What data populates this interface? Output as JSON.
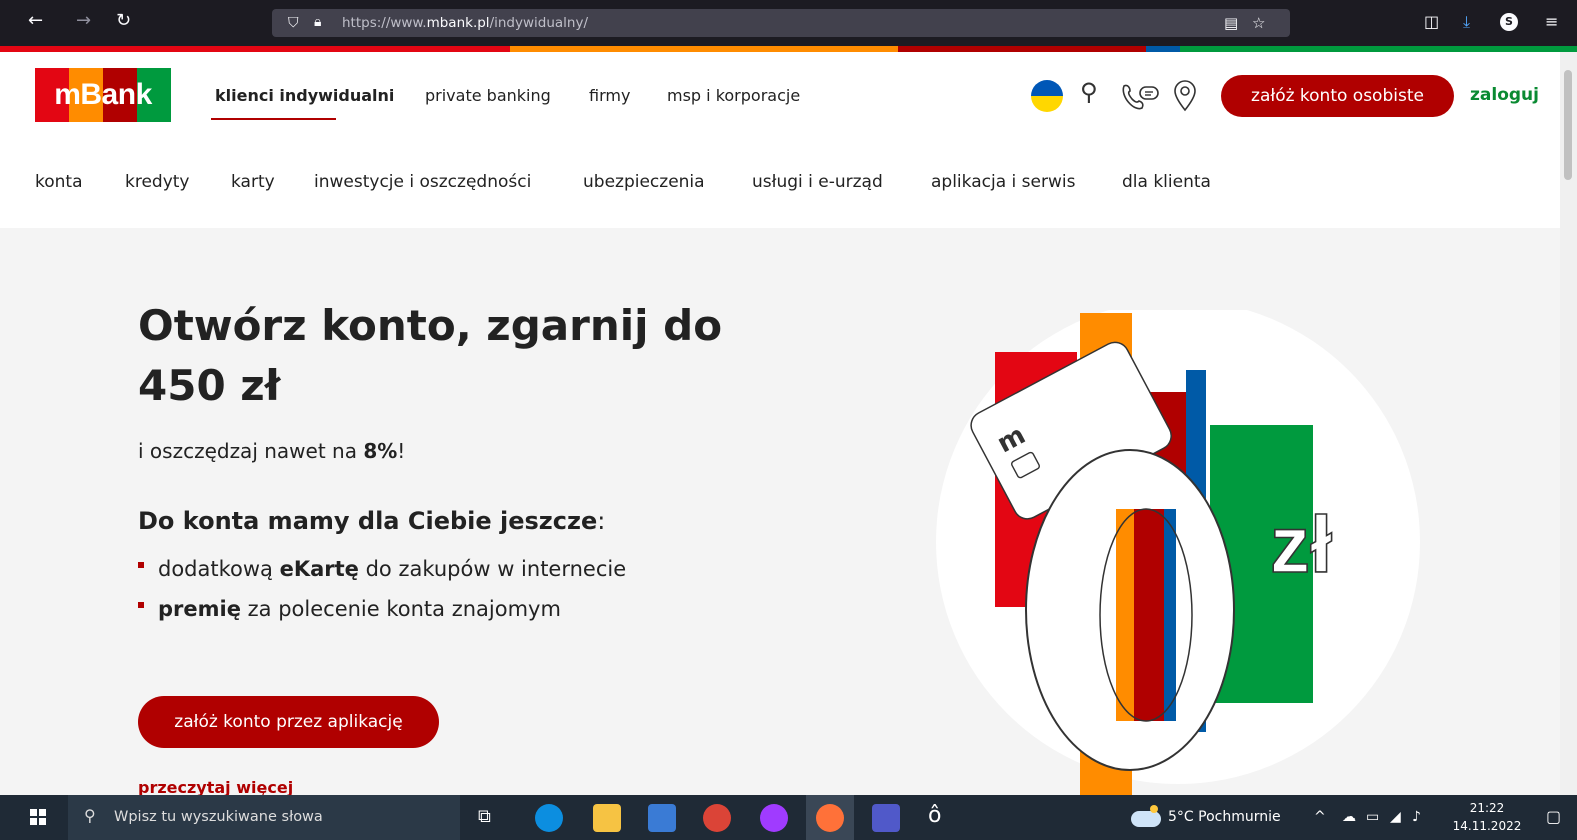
{
  "browser": {
    "url_prefix": "https://www.",
    "url_domain": "mbank.pl",
    "url_path": "/indywidualny/"
  },
  "header": {
    "logo_text": "mBank",
    "top_nav": [
      "klienci indywidualni",
      "private banking",
      "firmy",
      "msp i korporacje"
    ],
    "cta_label": "załóż konto osobiste",
    "login_label": "zaloguj",
    "sub_nav": [
      "konta",
      "kredyty",
      "karty",
      "inwestycje i oszczędności",
      "ubezpieczenia",
      "usługi i e-urząd",
      "aplikacja i serwis",
      "dla klienta"
    ]
  },
  "hero": {
    "title": "Otwórz konto, zgarnij do 450 zł",
    "subtitle_prefix": "i oszczędzaj nawet na ",
    "subtitle_bold": "8%",
    "subtitle_suffix": "!",
    "extras_title_bold": "Do konta mamy dla Ciebie jeszcze",
    "extras_title_suffix": ":",
    "bullets": [
      {
        "prefix": "dodatkową ",
        "bold": "eKartę",
        "suffix": " do zakupów w internecie"
      },
      {
        "prefix": "",
        "bold": "premię",
        "suffix": " za polecenie konta znajomym"
      }
    ],
    "cta_label": "załóż konto przez aplikację",
    "read_more": "przeczytaj więcej",
    "illustration_text": "0",
    "illustration_unit": "zł",
    "card_logo": "m"
  },
  "taskbar": {
    "search_placeholder": "Wpisz tu wyszukiwane słowa",
    "weather": "5°C  Pochmurnie",
    "time": "21:22",
    "date": "14.11.2022"
  },
  "colors": {
    "brand_red": "#b00000",
    "brand_green": "#0a8a32",
    "logo_blocks": [
      "#e30613",
      "#ff8c00",
      "#b00000",
      "#009a3e"
    ]
  }
}
